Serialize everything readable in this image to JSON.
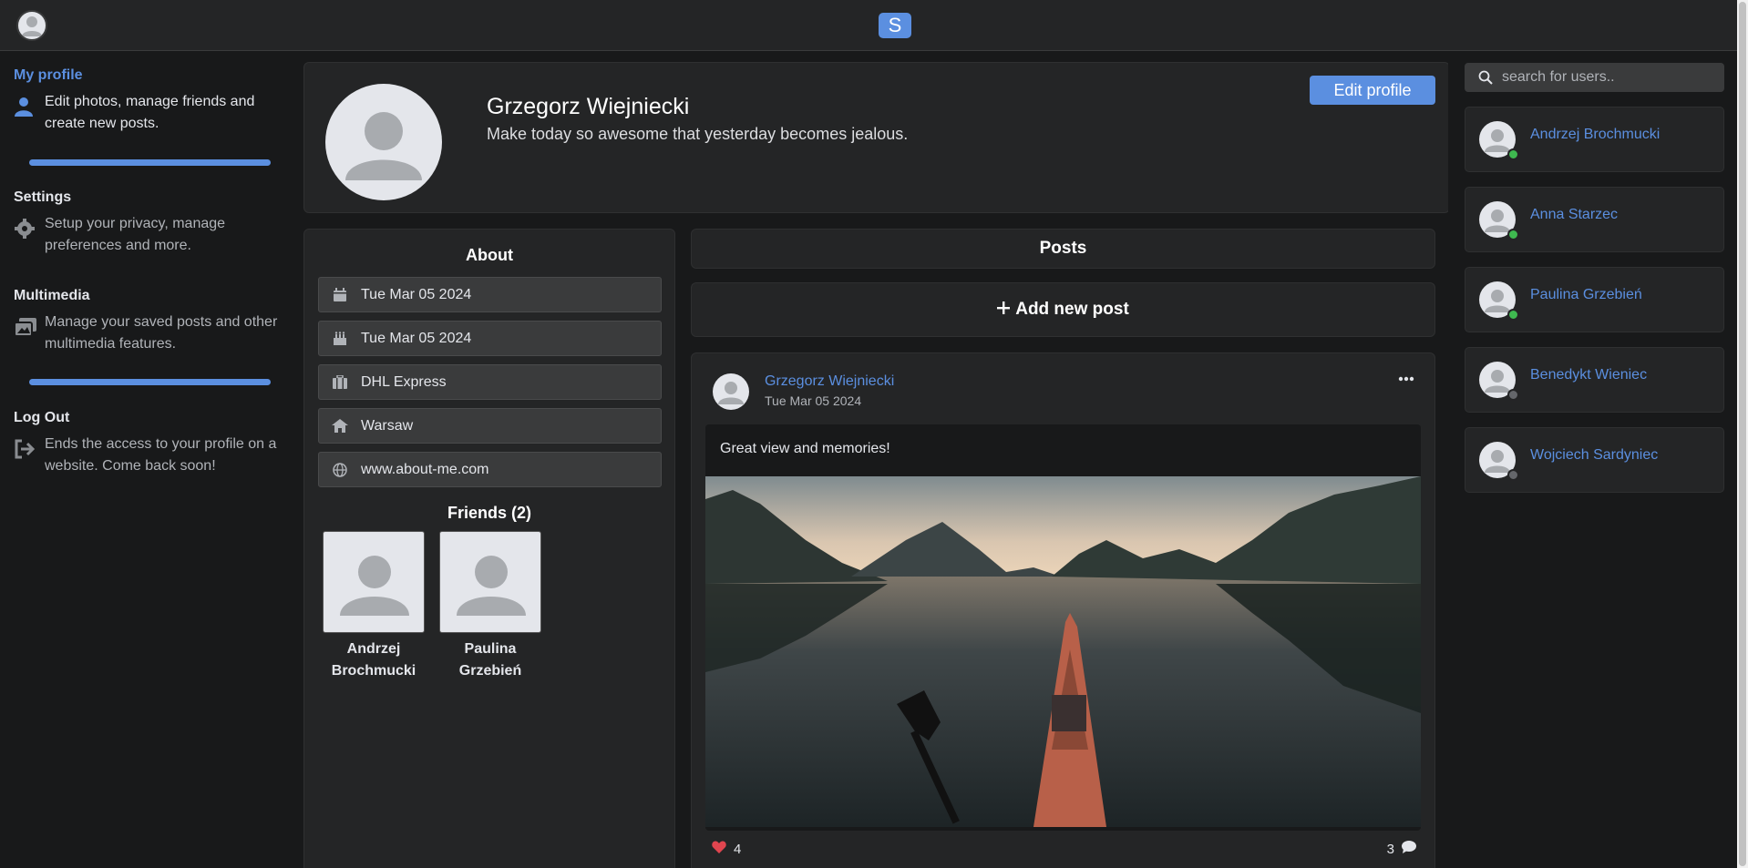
{
  "app": {
    "logo_letter": "S"
  },
  "sidebar": {
    "items": [
      {
        "title": "My profile",
        "desc": "Edit photos, manage friends and create new posts."
      },
      {
        "title": "Settings",
        "desc": "Setup your privacy, manage preferences and more."
      },
      {
        "title": "Multimedia",
        "desc": "Manage your saved posts and other multimedia features."
      },
      {
        "title": "Log Out",
        "desc": "Ends the access to your profile on a website. Come back soon!"
      }
    ]
  },
  "profile": {
    "name": "Grzegorz Wiejniecki",
    "bio": "Make today so awesome that yesterday becomes jealous.",
    "edit_label": "Edit profile"
  },
  "about": {
    "title": "About",
    "items": [
      {
        "icon": "calendar-icon",
        "text": "Tue Mar 05 2024"
      },
      {
        "icon": "birthday-cake-icon",
        "text": "Tue Mar 05 2024"
      },
      {
        "icon": "briefcase-icon",
        "text": "DHL Express"
      },
      {
        "icon": "home-icon",
        "text": "Warsaw"
      },
      {
        "icon": "globe-icon",
        "text": "www.about-me.com"
      }
    ],
    "friends_title": "Friends (2)",
    "friends": [
      {
        "name": "Andrzej Brochmucki"
      },
      {
        "name": "Paulina Grzebień"
      }
    ]
  },
  "posts": {
    "title": "Posts",
    "add_label": "Add new post",
    "items": [
      {
        "author": "Grzegorz Wiejniecki",
        "date": "Tue Mar 05 2024",
        "text": "Great view and memories!",
        "likes": "4",
        "comments": "3"
      }
    ]
  },
  "search": {
    "placeholder": "search for users.."
  },
  "users": [
    {
      "name": "Andrzej Brochmucki",
      "online": true
    },
    {
      "name": "Anna Starzec",
      "online": true
    },
    {
      "name": "Paulina Grzebień",
      "online": true
    },
    {
      "name": "Benedykt Wieniec",
      "online": false
    },
    {
      "name": "Wojciech Sardyniec",
      "online": false
    }
  ],
  "colors": {
    "accent": "#5b8fe0",
    "online": "#3fb950",
    "offline": "#65676b",
    "like": "#e0454f"
  }
}
